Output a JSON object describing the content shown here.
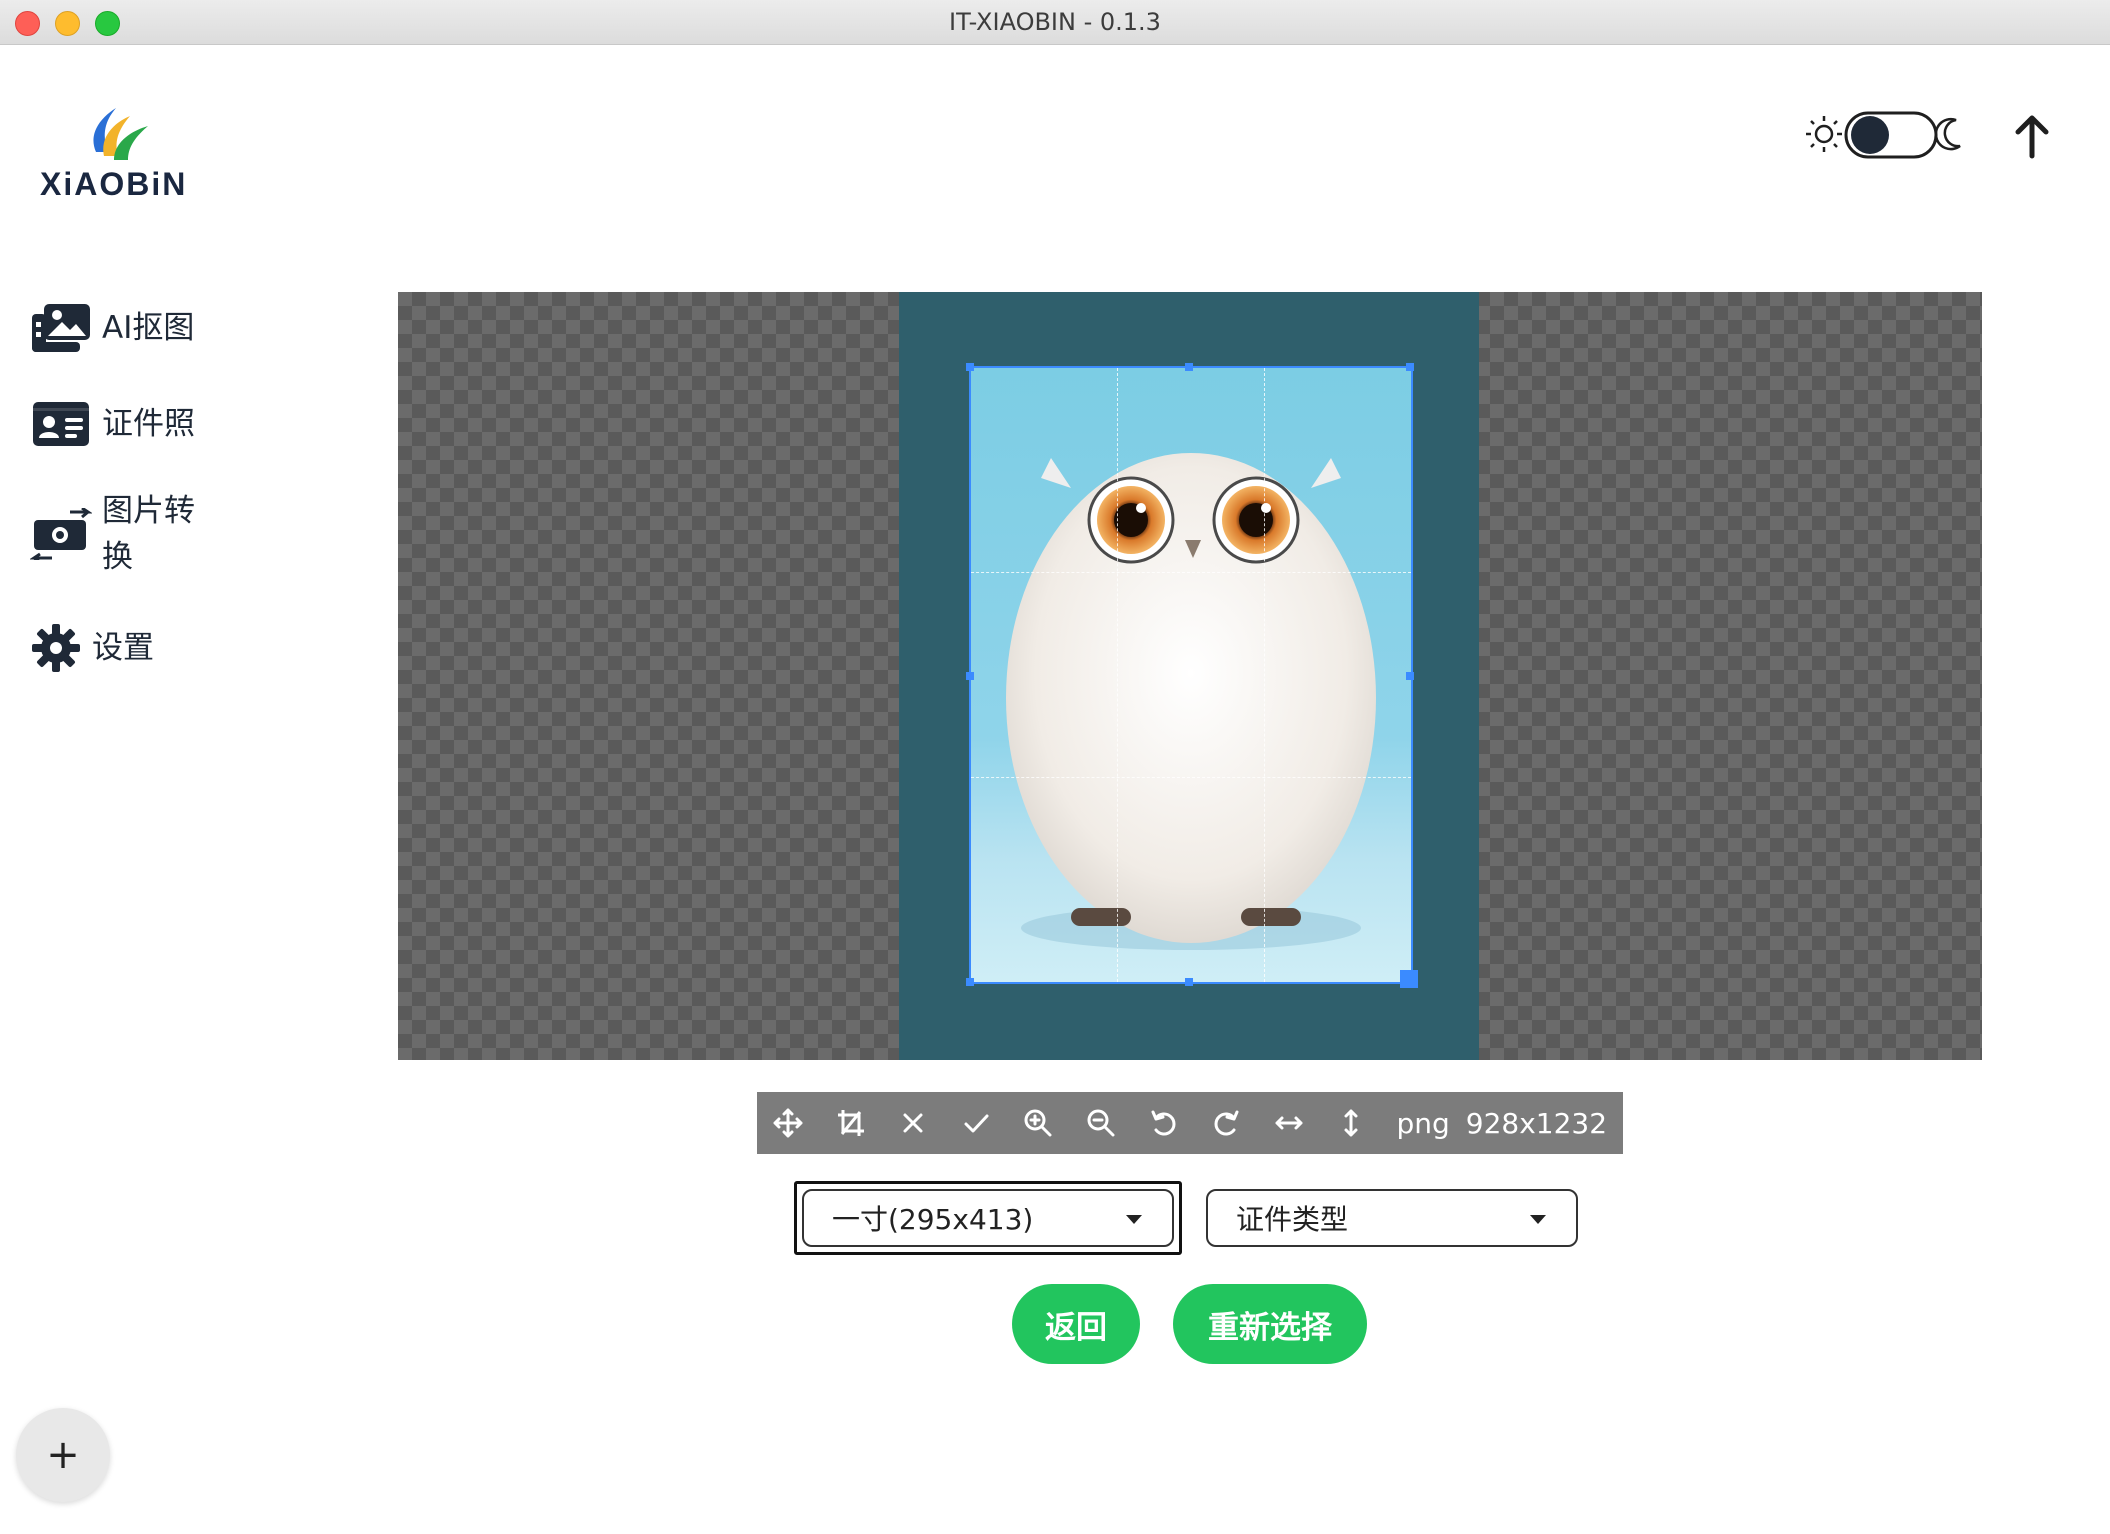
{
  "window": {
    "title": "IT-XIAOBIN - 0.1.3"
  },
  "logo": {
    "text": "XiAOBiN"
  },
  "sidebar": {
    "items": [
      {
        "label": "AI抠图",
        "icon": "images-icon"
      },
      {
        "label": "证件照",
        "icon": "id-card-icon"
      },
      {
        "label": "图片转换",
        "icon": "money-transfer-icon"
      },
      {
        "label": "设置",
        "icon": "gear-icon"
      }
    ],
    "add_label": "+"
  },
  "header": {
    "theme_toggle": {
      "state": "dark",
      "left_icon": "sun-icon",
      "right_icon": "moon-icon"
    },
    "upload_icon": "arrow-up-icon"
  },
  "editor": {
    "toolbar": {
      "tools": [
        "move-icon",
        "crop-icon",
        "clear-icon",
        "confirm-icon",
        "zoom-in-icon",
        "zoom-out-icon",
        "rotate-left-icon",
        "rotate-right-icon",
        "flip-horizontal-icon",
        "flip-vertical-icon"
      ],
      "format": "png",
      "dimensions": "928x1232"
    },
    "colors": {
      "photo_background": "#2f5f6c",
      "crop_border": "#3b8bff"
    }
  },
  "form": {
    "size_select": {
      "value": "一寸(295x413)"
    },
    "type_select": {
      "value": "证件类型"
    }
  },
  "buttons": {
    "back": "返回",
    "reselect": "重新选择",
    "accent": "#22c55e"
  }
}
